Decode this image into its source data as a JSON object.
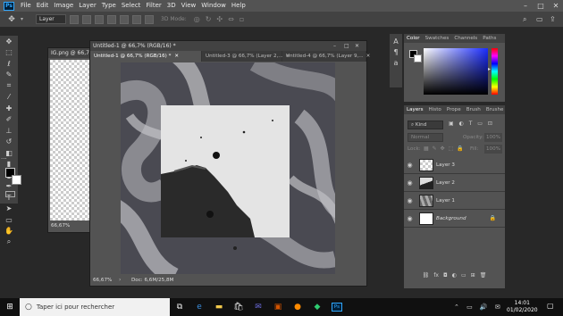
{
  "menubar": {
    "items": [
      "File",
      "Edit",
      "Image",
      "Layer",
      "Type",
      "Select",
      "Filter",
      "3D",
      "View",
      "Window",
      "Help"
    ],
    "logo": "Ps"
  },
  "options": {
    "auto_select_value": "Layer",
    "mode_3d_label": "3D Mode:"
  },
  "doc_back": {
    "title": "IG.png @ 66,7",
    "zoom": "66,67%"
  },
  "doc_front": {
    "title": "Untitled-1 @ 66,7% (RGB/16) *",
    "tabs": [
      "Untitled-1 @ 66,7% (RGB/16) *",
      "Untitled-3 @ 66,7% (Layer 2,...",
      "Untitled-4 @ 66,7% (Layer 9,..."
    ],
    "zoom": "66,67%",
    "doc_info": "Doc: 6,6M/25,8M"
  },
  "panels": {
    "color_tabs": [
      "Color",
      "Swatches",
      "Channels",
      "Paths"
    ],
    "layer_tabs": [
      "Layers",
      "Histo",
      "Prope",
      "Brush",
      "Brushe"
    ],
    "kind_label": "Kind",
    "blend_mode": "Normal",
    "opacity_label": "Opacity:",
    "opacity_value": "100%",
    "lock_label": "Lock:",
    "fill_label": "Fill:",
    "fill_value": "100%"
  },
  "layers": [
    {
      "name": "Layer 3",
      "selected": false
    },
    {
      "name": "Layer 2",
      "selected": false
    },
    {
      "name": "Layer 1",
      "selected": false
    },
    {
      "name": "Background",
      "selected": false,
      "locked": true
    }
  ],
  "taskbar": {
    "search_placeholder": "Taper ici pour rechercher",
    "time": "14:01",
    "date": "01/02/2020"
  },
  "colors": {
    "ps_blue": "#31a8ff",
    "panel_bg": "#535353",
    "app_bg": "#282828"
  }
}
